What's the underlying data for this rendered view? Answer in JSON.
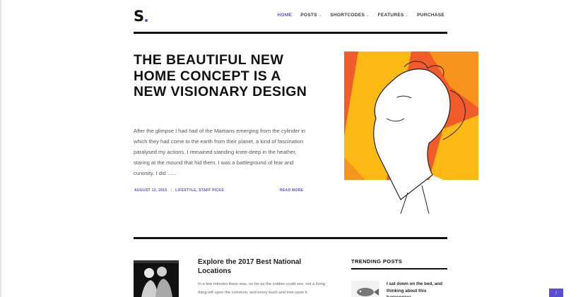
{
  "header": {
    "logo_text": "S",
    "nav": [
      {
        "label": "HOME",
        "has_dropdown": false
      },
      {
        "label": "POSTS",
        "has_dropdown": true
      },
      {
        "label": "SHORTCODES",
        "has_dropdown": true
      },
      {
        "label": "FEATURES",
        "has_dropdown": true
      },
      {
        "label": "PURCHASE",
        "has_dropdown": false
      }
    ],
    "dropdown_icon": "chevron-down-icon"
  },
  "hero": {
    "title": "THE BEAUTIFUL NEW HOME CONCEPT IS A NEW VISIONARY DESIGN",
    "excerpt": "After the glimpse I had had of the Martians emerging from the cylinder in which they had come to the earth from their planet, a kind of fascination paralysed my actions. I remained standing knee-deep in the heather, staring at the mound that hid them. I was a battleground of fear and curiosity. I did ......",
    "date": "AUGUST 13, 2015",
    "separator": "|",
    "categories": "LIFESTYLE, STAFF PICKS",
    "read_more": "READ MORE"
  },
  "featured_post": {
    "title": "Explore the 2017 Best National Locations",
    "excerpt": "In a few minutes there was, so far as the soldier could see, not a living thing left upon the common, and every bush and tree upon it"
  },
  "trending": {
    "heading": "TRENDING POSTS",
    "items": [
      {
        "title": "I sat down on the bed, and thinking about this harpooneer"
      }
    ]
  },
  "back_to_top": "↑",
  "colors": {
    "accent": "#5b4fd1",
    "text": "#111111",
    "art_orange": "#f15a29",
    "art_yellow": "#fdb913"
  }
}
